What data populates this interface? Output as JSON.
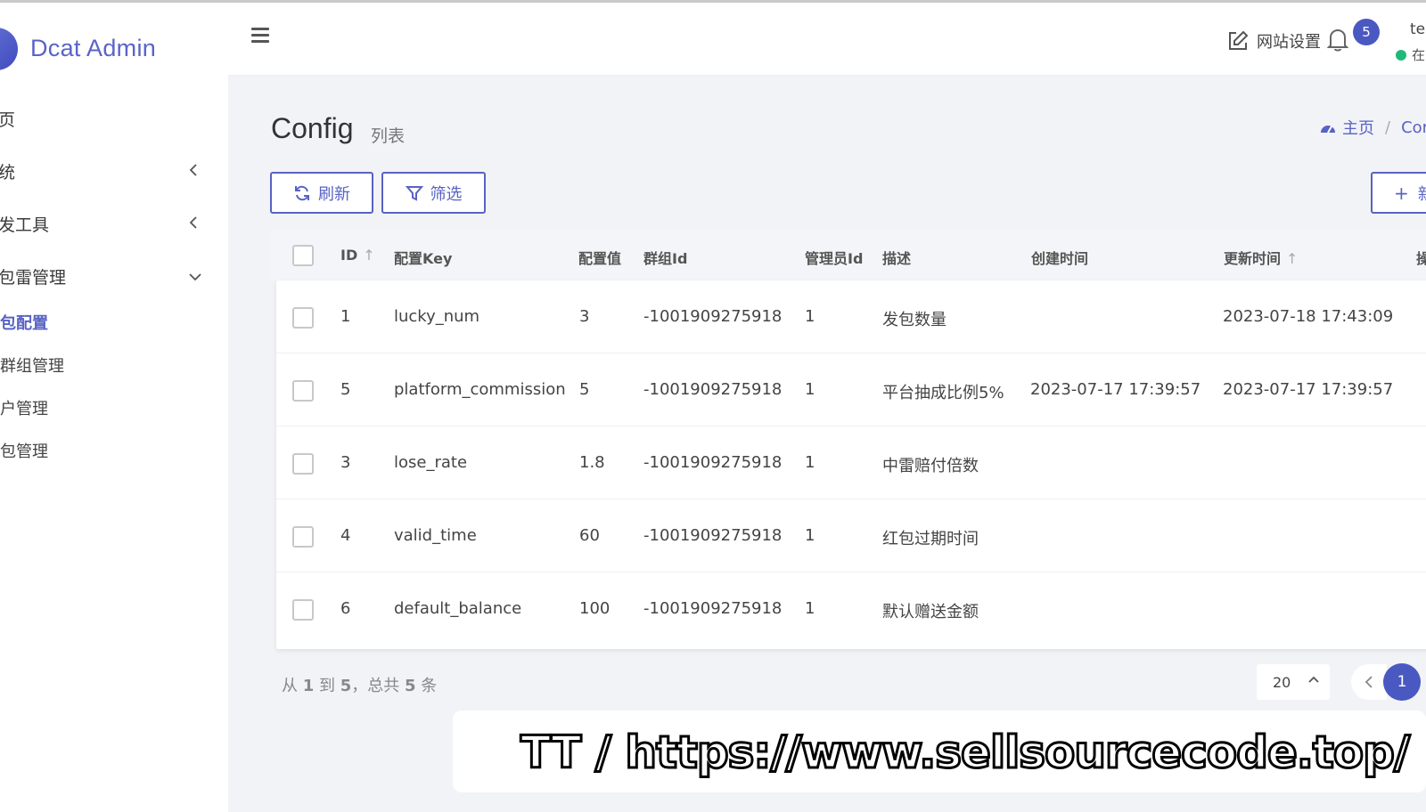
{
  "app": {
    "title": "Dcat Admin"
  },
  "sidebar": {
    "items": [
      {
        "label": "页",
        "chevron": ""
      },
      {
        "label": "统",
        "chevron": "‹"
      },
      {
        "label": "发工具",
        "chevron": "‹"
      },
      {
        "label": "包雷管理",
        "chevron": "⌄"
      }
    ],
    "subitems": [
      {
        "label": "包配置",
        "active": true
      },
      {
        "label": "群组管理",
        "active": false
      },
      {
        "label": "户管理",
        "active": false
      },
      {
        "label": "包管理",
        "active": false
      }
    ]
  },
  "header": {
    "site_settings": "网站设置",
    "notification_count": "5",
    "user_name": "tes",
    "user_status": "在"
  },
  "page": {
    "title": "Config",
    "subtitle": "列表",
    "breadcrumb": {
      "home": "主页",
      "sep": "/",
      "current": "Cor"
    }
  },
  "toolbar": {
    "refresh_label": "刷新",
    "filter_label": "筛选",
    "new_label": "新"
  },
  "table": {
    "columns": {
      "id": "ID",
      "key": "配置Key",
      "value": "配置值",
      "group": "群组Id",
      "admin": "管理员Id",
      "desc": "描述",
      "created": "创建时间",
      "updated": "更新时间",
      "actions": "操"
    },
    "rows": [
      {
        "id": "1",
        "key": "lucky_num",
        "value": "3",
        "group": "-1001909275918",
        "admin": "1",
        "desc": "发包数量",
        "created": "",
        "updated": "2023-07-18 17:43:09"
      },
      {
        "id": "5",
        "key": "platform_commission",
        "value": "5",
        "group": "-1001909275918",
        "admin": "1",
        "desc": "平台抽成比例5%",
        "created": "2023-07-17 17:39:57",
        "updated": "2023-07-17 17:39:57"
      },
      {
        "id": "3",
        "key": "lose_rate",
        "value": "1.8",
        "group": "-1001909275918",
        "admin": "1",
        "desc": "中雷赔付倍数",
        "created": "",
        "updated": ""
      },
      {
        "id": "4",
        "key": "valid_time",
        "value": "60",
        "group": "-1001909275918",
        "admin": "1",
        "desc": "红包过期时间",
        "created": "",
        "updated": ""
      },
      {
        "id": "6",
        "key": "default_balance",
        "value": "100",
        "group": "-1001909275918",
        "admin": "1",
        "desc": "默认赠送金额",
        "created": "",
        "updated": ""
      }
    ]
  },
  "pagination": {
    "summary_prefix": "从",
    "from": "1",
    "summary_to": "到",
    "to": "5",
    "summary_total": "，总共",
    "total": "5",
    "summary_suffix": "条",
    "per_page": "20",
    "current_page": "1"
  },
  "watermark": {
    "text": "TT / https://www.sellsourcecode.top/"
  },
  "colors": {
    "accent": "#5862c4",
    "badge": "#4a58c2",
    "online": "#21b978"
  }
}
